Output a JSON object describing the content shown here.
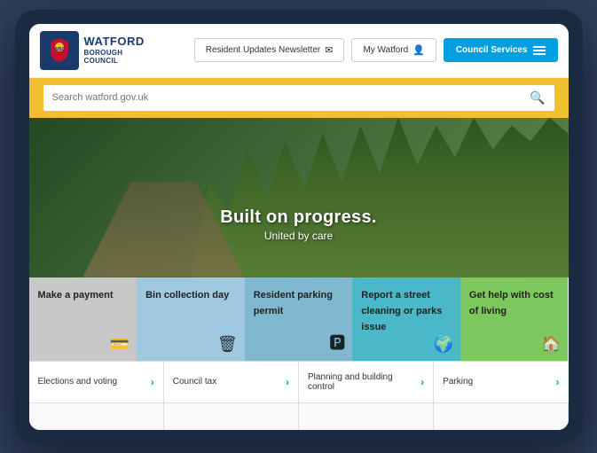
{
  "device": {
    "frame_label": "browser-device"
  },
  "header": {
    "logo": {
      "watford": "WATFORD",
      "borough_council": "BOROUGH\nCOUNCIL"
    },
    "nav_items": [
      {
        "id": "newsletter",
        "label": "Resident Updates Newsletter",
        "icon": "✉"
      },
      {
        "id": "my_watford",
        "label": "My Watford",
        "icon": "👤"
      }
    ],
    "council_services_btn": "Council Services"
  },
  "search": {
    "placeholder": "Search watford.gov.uk",
    "icon": "🔍"
  },
  "hero": {
    "title": "Built on progress.",
    "subtitle": "United by care"
  },
  "tiles": [
    {
      "id": "payment",
      "label": "Make a payment",
      "icon": "💳",
      "color": "tile-payment"
    },
    {
      "id": "bin",
      "label": "Bin collection day",
      "icon": "🗑",
      "color": "tile-bin"
    },
    {
      "id": "parking",
      "label": "Resident parking permit",
      "icon": "🅿",
      "color": "tile-parking"
    },
    {
      "id": "street",
      "label": "Report a street cleaning or parks issue",
      "icon": "🌍",
      "color": "tile-street"
    },
    {
      "id": "cost",
      "label": "Get help with cost of living",
      "icon": "🏠",
      "color": "tile-cost"
    }
  ],
  "bottom_links": [
    {
      "id": "elections",
      "label": "Elections and voting"
    },
    {
      "id": "council_tax",
      "label": "Council tax"
    },
    {
      "id": "planning",
      "label": "Planning and building control"
    },
    {
      "id": "parking",
      "label": "Parking"
    }
  ]
}
